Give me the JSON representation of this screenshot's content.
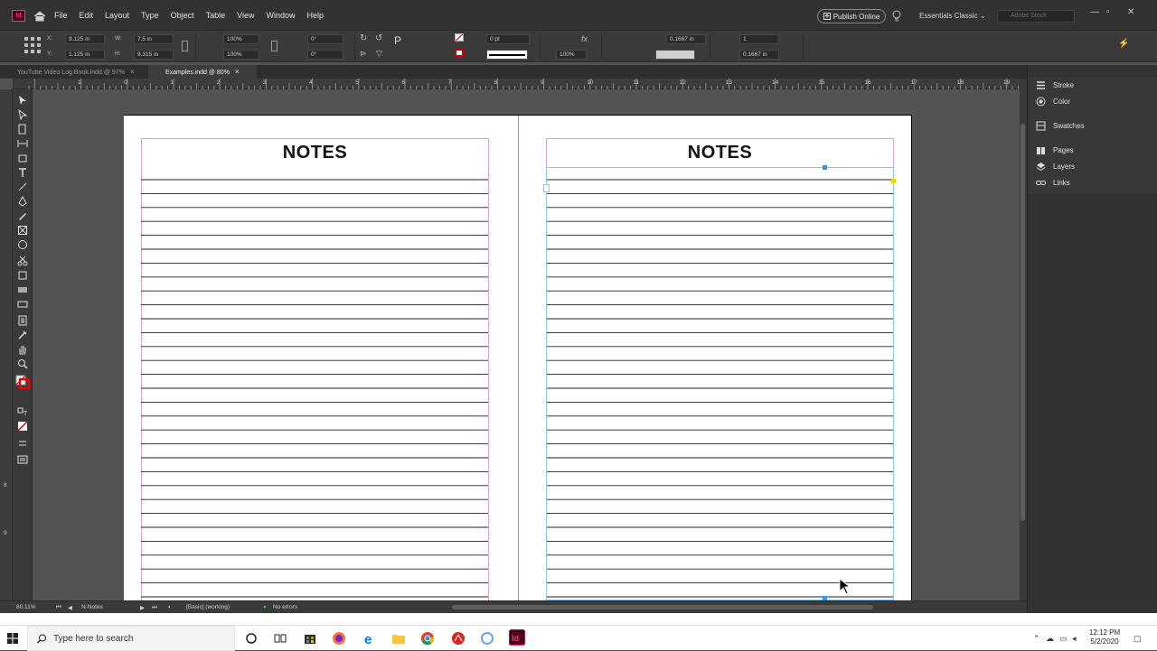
{
  "app": {
    "logo_text": "Id"
  },
  "menu": [
    "File",
    "Edit",
    "Layout",
    "Type",
    "Object",
    "Table",
    "View",
    "Window",
    "Help"
  ],
  "publish_label": "Publish Online",
  "workspace_label": "Essentials Classic",
  "search_stock_placeholder": "Adobe Stock",
  "control": {
    "x_label": "X:",
    "x_value": "9.125 in",
    "y_label": "Y:",
    "y_value": "1.125 in",
    "w_label": "W:",
    "w_value": "7.5 in",
    "h_label": "H:",
    "h_value": "9.315 in",
    "scale_x": "100%",
    "scale_y": "100%",
    "rotate": "0°",
    "shear": "0°",
    "stroke_weight": "0 pt",
    "opacity": "100%",
    "offset_1": "0.1667 in",
    "columns": "1",
    "offset_2": "0.1667 in"
  },
  "tabs": [
    {
      "label": "YouTube Video Log Book.indd @ 97%",
      "close": "×",
      "active": false
    },
    {
      "label": "Examples.indd @ 80%",
      "close": "×",
      "active": true
    }
  ],
  "ruler_h": [
    "1",
    "0",
    "1",
    "2",
    "3",
    "4",
    "5",
    "6",
    "7",
    "8",
    "9",
    "10",
    "11",
    "12",
    "13",
    "14",
    "15",
    "16",
    "17",
    "18",
    "19"
  ],
  "ruler_v": [
    "8",
    "9"
  ],
  "pages": [
    {
      "title": "NOTES"
    },
    {
      "title": "NOTES"
    }
  ],
  "panels": [
    {
      "label": "Stroke",
      "icon": "stroke-icon"
    },
    {
      "label": "Color",
      "icon": "color-icon"
    },
    {
      "label": "Swatches",
      "icon": "swatches-icon"
    },
    {
      "label": "Pages",
      "icon": "pages-icon"
    },
    {
      "label": "Layers",
      "icon": "layers-icon"
    },
    {
      "label": "Links",
      "icon": "links-icon"
    }
  ],
  "status": {
    "zoom": "80.11%",
    "page": "N-Notes",
    "style": "[Basic] (working)",
    "errors": "No errors"
  },
  "taskbar": {
    "search_placeholder": "Type here to search",
    "time": "12:12 PM",
    "date": "5/2/2020"
  }
}
